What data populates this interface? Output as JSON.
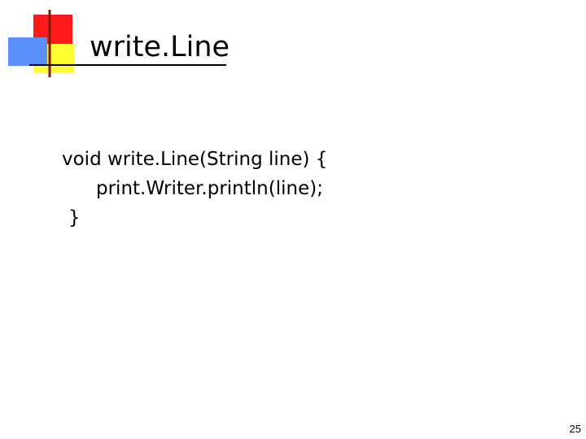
{
  "slide": {
    "title": "write.Line",
    "code_lines": [
      "void write.Line(String line) {",
      "print.Writer.println(line);",
      "}"
    ],
    "page_number": "25"
  },
  "logo": {
    "icon": "overlapping-squares-logo-icon",
    "colors": {
      "red": "#ff1a1a",
      "yellow": "#ffff33",
      "blue": "#5b8ff9",
      "line": "#7a1f00"
    }
  }
}
